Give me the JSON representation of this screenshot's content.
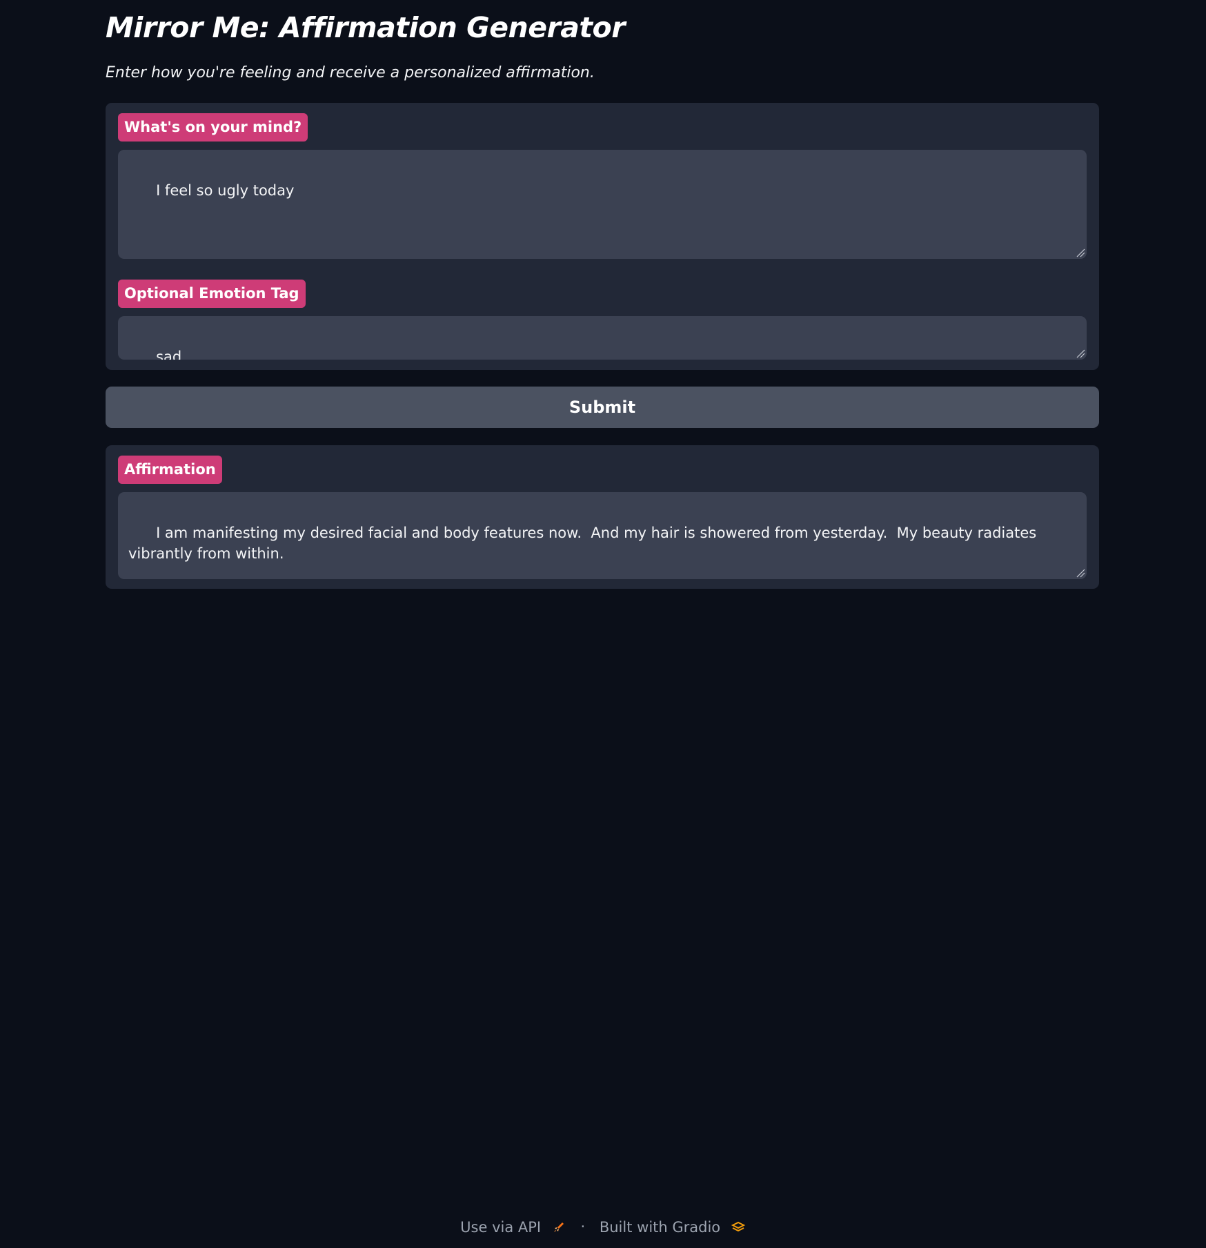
{
  "app": {
    "title": "Mirror Me: Affirmation Generator",
    "subtitle": "Enter how you're feeling and receive a personalized affirmation."
  },
  "inputs": {
    "mind": {
      "label": "What's on your mind?",
      "value": "I feel so ugly today"
    },
    "emotion": {
      "label": "Optional Emotion Tag",
      "value": "sad"
    }
  },
  "submit": {
    "label": "Submit"
  },
  "output": {
    "label": "Affirmation",
    "value": "I am manifesting my desired facial and body features now.  And my hair is showered from yesterday.  My beauty radiates vibrantly from within."
  },
  "footer": {
    "api_label": "Use via API",
    "separator": "·",
    "built_label": "Built with Gradio",
    "api_icon": "rocket-icon",
    "gradio_icon": "gradio-logo-icon"
  },
  "colors": {
    "background": "#0b0f19",
    "panel": "#222837",
    "input": "#3b4152",
    "label_accent": "#ce3c77",
    "button": "#4b5261"
  }
}
